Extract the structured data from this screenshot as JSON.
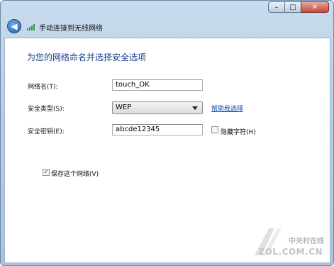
{
  "window": {
    "caption": {
      "minimize": "–",
      "maximize": "□",
      "close": "✕"
    },
    "nav_title": "手动连接到无线网络"
  },
  "content": {
    "heading": "为您的网络命名并选择安全选项",
    "network_name": {
      "label": "网络名(T):",
      "value": "touch_OK"
    },
    "security_type": {
      "label": "安全类型(S):",
      "value": "WEP",
      "help_link": "帮助我选择"
    },
    "security_key": {
      "label": "安全密钥(E):",
      "value": "abcde12345",
      "hide_chars_label": "隐藏字符(H)",
      "hide_chars_checked": false
    },
    "save_network": {
      "label": "保存这个网络(V)",
      "checked": true
    }
  },
  "watermark": {
    "line1": "中关村在线",
    "line2": "ZOL.COM.CN"
  },
  "colors": {
    "heading": "#1b3e8a",
    "link": "#0645ad",
    "chrome": "#b7cde4"
  }
}
